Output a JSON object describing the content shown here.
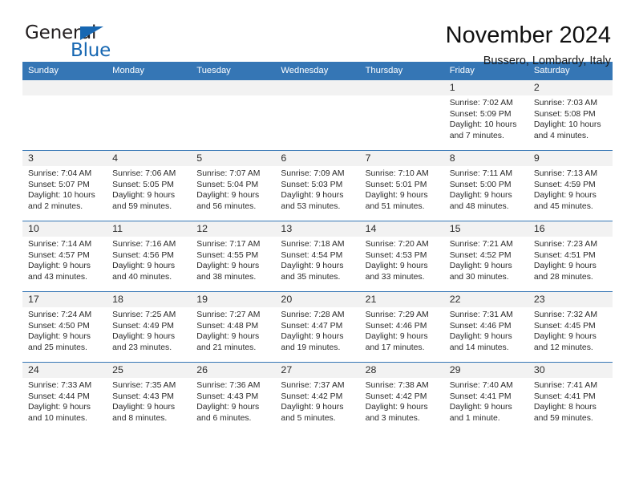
{
  "logo": {
    "word_top": "General",
    "word_bottom": "Blue",
    "triangle_color": "#1767b2"
  },
  "header": {
    "month_title": "November 2024",
    "location": "Bussero, Lombardy, Italy"
  },
  "colors": {
    "header_blue": "#3576b5",
    "daynum_band": "#f2f2f2",
    "text": "#2b2b2b"
  },
  "calendar": {
    "weekday_headers": [
      "Sunday",
      "Monday",
      "Tuesday",
      "Wednesday",
      "Thursday",
      "Friday",
      "Saturday"
    ],
    "labels": {
      "sunrise": "Sunrise:",
      "sunset": "Sunset:",
      "daylight": "Daylight:"
    },
    "weeks": [
      [
        {
          "day": "",
          "empty": true
        },
        {
          "day": "",
          "empty": true
        },
        {
          "day": "",
          "empty": true
        },
        {
          "day": "",
          "empty": true
        },
        {
          "day": "",
          "empty": true
        },
        {
          "day": "1",
          "sunrise": "Sunrise: 7:02 AM",
          "sunset": "Sunset: 5:09 PM",
          "daylight_l1": "Daylight: 10 hours",
          "daylight_l2": "and 7 minutes."
        },
        {
          "day": "2",
          "sunrise": "Sunrise: 7:03 AM",
          "sunset": "Sunset: 5:08 PM",
          "daylight_l1": "Daylight: 10 hours",
          "daylight_l2": "and 4 minutes."
        }
      ],
      [
        {
          "day": "3",
          "sunrise": "Sunrise: 7:04 AM",
          "sunset": "Sunset: 5:07 PM",
          "daylight_l1": "Daylight: 10 hours",
          "daylight_l2": "and 2 minutes."
        },
        {
          "day": "4",
          "sunrise": "Sunrise: 7:06 AM",
          "sunset": "Sunset: 5:05 PM",
          "daylight_l1": "Daylight: 9 hours",
          "daylight_l2": "and 59 minutes."
        },
        {
          "day": "5",
          "sunrise": "Sunrise: 7:07 AM",
          "sunset": "Sunset: 5:04 PM",
          "daylight_l1": "Daylight: 9 hours",
          "daylight_l2": "and 56 minutes."
        },
        {
          "day": "6",
          "sunrise": "Sunrise: 7:09 AM",
          "sunset": "Sunset: 5:03 PM",
          "daylight_l1": "Daylight: 9 hours",
          "daylight_l2": "and 53 minutes."
        },
        {
          "day": "7",
          "sunrise": "Sunrise: 7:10 AM",
          "sunset": "Sunset: 5:01 PM",
          "daylight_l1": "Daylight: 9 hours",
          "daylight_l2": "and 51 minutes."
        },
        {
          "day": "8",
          "sunrise": "Sunrise: 7:11 AM",
          "sunset": "Sunset: 5:00 PM",
          "daylight_l1": "Daylight: 9 hours",
          "daylight_l2": "and 48 minutes."
        },
        {
          "day": "9",
          "sunrise": "Sunrise: 7:13 AM",
          "sunset": "Sunset: 4:59 PM",
          "daylight_l1": "Daylight: 9 hours",
          "daylight_l2": "and 45 minutes."
        }
      ],
      [
        {
          "day": "10",
          "sunrise": "Sunrise: 7:14 AM",
          "sunset": "Sunset: 4:57 PM",
          "daylight_l1": "Daylight: 9 hours",
          "daylight_l2": "and 43 minutes."
        },
        {
          "day": "11",
          "sunrise": "Sunrise: 7:16 AM",
          "sunset": "Sunset: 4:56 PM",
          "daylight_l1": "Daylight: 9 hours",
          "daylight_l2": "and 40 minutes."
        },
        {
          "day": "12",
          "sunrise": "Sunrise: 7:17 AM",
          "sunset": "Sunset: 4:55 PM",
          "daylight_l1": "Daylight: 9 hours",
          "daylight_l2": "and 38 minutes."
        },
        {
          "day": "13",
          "sunrise": "Sunrise: 7:18 AM",
          "sunset": "Sunset: 4:54 PM",
          "daylight_l1": "Daylight: 9 hours",
          "daylight_l2": "and 35 minutes."
        },
        {
          "day": "14",
          "sunrise": "Sunrise: 7:20 AM",
          "sunset": "Sunset: 4:53 PM",
          "daylight_l1": "Daylight: 9 hours",
          "daylight_l2": "and 33 minutes."
        },
        {
          "day": "15",
          "sunrise": "Sunrise: 7:21 AM",
          "sunset": "Sunset: 4:52 PM",
          "daylight_l1": "Daylight: 9 hours",
          "daylight_l2": "and 30 minutes."
        },
        {
          "day": "16",
          "sunrise": "Sunrise: 7:23 AM",
          "sunset": "Sunset: 4:51 PM",
          "daylight_l1": "Daylight: 9 hours",
          "daylight_l2": "and 28 minutes."
        }
      ],
      [
        {
          "day": "17",
          "sunrise": "Sunrise: 7:24 AM",
          "sunset": "Sunset: 4:50 PM",
          "daylight_l1": "Daylight: 9 hours",
          "daylight_l2": "and 25 minutes."
        },
        {
          "day": "18",
          "sunrise": "Sunrise: 7:25 AM",
          "sunset": "Sunset: 4:49 PM",
          "daylight_l1": "Daylight: 9 hours",
          "daylight_l2": "and 23 minutes."
        },
        {
          "day": "19",
          "sunrise": "Sunrise: 7:27 AM",
          "sunset": "Sunset: 4:48 PM",
          "daylight_l1": "Daylight: 9 hours",
          "daylight_l2": "and 21 minutes."
        },
        {
          "day": "20",
          "sunrise": "Sunrise: 7:28 AM",
          "sunset": "Sunset: 4:47 PM",
          "daylight_l1": "Daylight: 9 hours",
          "daylight_l2": "and 19 minutes."
        },
        {
          "day": "21",
          "sunrise": "Sunrise: 7:29 AM",
          "sunset": "Sunset: 4:46 PM",
          "daylight_l1": "Daylight: 9 hours",
          "daylight_l2": "and 17 minutes."
        },
        {
          "day": "22",
          "sunrise": "Sunrise: 7:31 AM",
          "sunset": "Sunset: 4:46 PM",
          "daylight_l1": "Daylight: 9 hours",
          "daylight_l2": "and 14 minutes."
        },
        {
          "day": "23",
          "sunrise": "Sunrise: 7:32 AM",
          "sunset": "Sunset: 4:45 PM",
          "daylight_l1": "Daylight: 9 hours",
          "daylight_l2": "and 12 minutes."
        }
      ],
      [
        {
          "day": "24",
          "sunrise": "Sunrise: 7:33 AM",
          "sunset": "Sunset: 4:44 PM",
          "daylight_l1": "Daylight: 9 hours",
          "daylight_l2": "and 10 minutes."
        },
        {
          "day": "25",
          "sunrise": "Sunrise: 7:35 AM",
          "sunset": "Sunset: 4:43 PM",
          "daylight_l1": "Daylight: 9 hours",
          "daylight_l2": "and 8 minutes."
        },
        {
          "day": "26",
          "sunrise": "Sunrise: 7:36 AM",
          "sunset": "Sunset: 4:43 PM",
          "daylight_l1": "Daylight: 9 hours",
          "daylight_l2": "and 6 minutes."
        },
        {
          "day": "27",
          "sunrise": "Sunrise: 7:37 AM",
          "sunset": "Sunset: 4:42 PM",
          "daylight_l1": "Daylight: 9 hours",
          "daylight_l2": "and 5 minutes."
        },
        {
          "day": "28",
          "sunrise": "Sunrise: 7:38 AM",
          "sunset": "Sunset: 4:42 PM",
          "daylight_l1": "Daylight: 9 hours",
          "daylight_l2": "and 3 minutes."
        },
        {
          "day": "29",
          "sunrise": "Sunrise: 7:40 AM",
          "sunset": "Sunset: 4:41 PM",
          "daylight_l1": "Daylight: 9 hours",
          "daylight_l2": "and 1 minute."
        },
        {
          "day": "30",
          "sunrise": "Sunrise: 7:41 AM",
          "sunset": "Sunset: 4:41 PM",
          "daylight_l1": "Daylight: 8 hours",
          "daylight_l2": "and 59 minutes."
        }
      ]
    ]
  }
}
